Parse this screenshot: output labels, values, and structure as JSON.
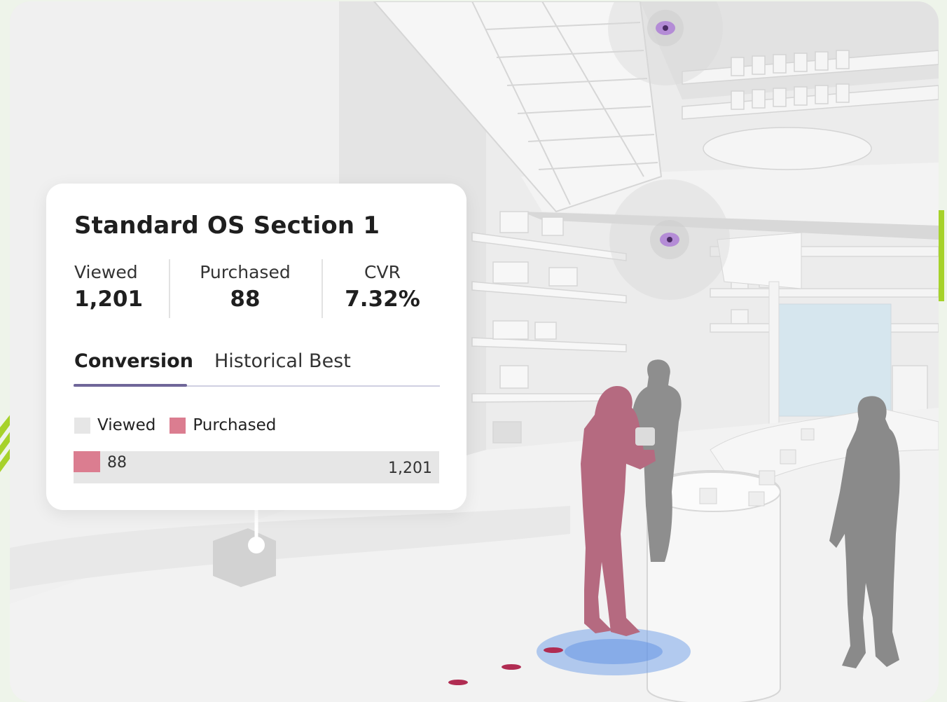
{
  "card": {
    "title": "Standard OS Section 1",
    "metrics": {
      "viewed": {
        "label": "Viewed",
        "value": "1,201"
      },
      "purchased": {
        "label": "Purchased",
        "value": "88"
      },
      "cvr": {
        "label": "CVR",
        "value": "7.32%"
      }
    },
    "tabs": [
      {
        "label": "Conversion",
        "active": true
      },
      {
        "label": "Historical Best",
        "active": false
      }
    ],
    "legend": [
      {
        "label": "Viewed",
        "color": "#e6e6e6"
      },
      {
        "label": "Purchased",
        "color": "#db7d90"
      }
    ],
    "bar": {
      "purchased_label": "88",
      "viewed_label": "1,201",
      "purchased_fraction": 0.0733
    }
  },
  "colors": {
    "accent_purple": "#6f6699",
    "purchased_pink": "#db7d90",
    "camera_violet": "#9b5fc0",
    "brand_green": "#a6d22a"
  },
  "scene_icons": [
    "camera-icon",
    "camera-icon",
    "shopper-silhouette",
    "shopper-silhouette",
    "shopper-silhouette"
  ]
}
